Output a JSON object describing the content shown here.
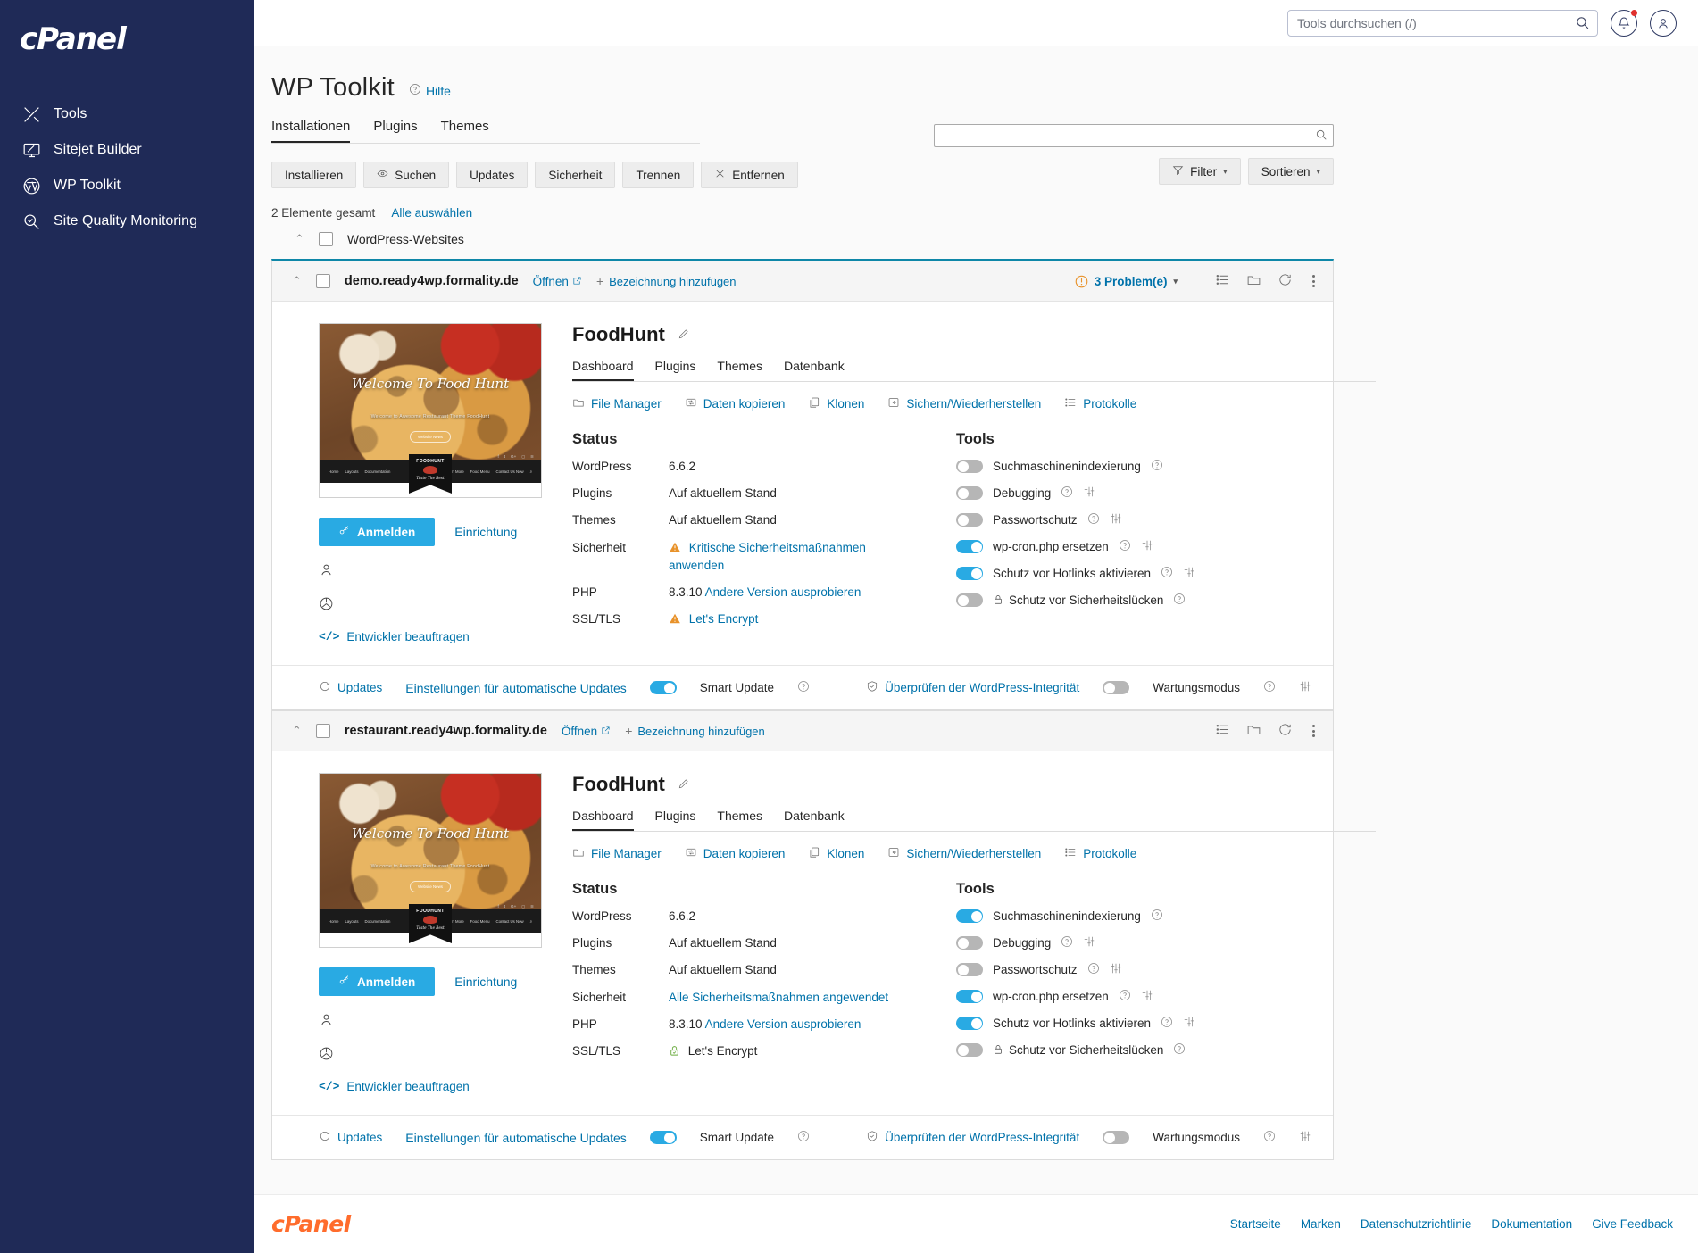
{
  "brand": {
    "logo_text": "cPanel",
    "footer_logo_text": "cPanel"
  },
  "sidebar": {
    "items": [
      {
        "label": "Tools",
        "icon": "tools-icon"
      },
      {
        "label": "Sitejet Builder",
        "icon": "monitor-icon"
      },
      {
        "label": "WP Toolkit",
        "icon": "wordpress-icon"
      },
      {
        "label": "Site Quality Monitoring",
        "icon": "magnifier-check-icon"
      }
    ]
  },
  "topbar": {
    "search_placeholder": "Tools durchsuchen (/)",
    "search_value": "",
    "notifications_icon": "bell-icon",
    "account_icon": "user-icon"
  },
  "page": {
    "title": "WP Toolkit",
    "help_label": "Hilfe",
    "tabs": [
      {
        "label": "Installationen",
        "active": true
      },
      {
        "label": "Plugins",
        "active": false
      },
      {
        "label": "Themes",
        "active": false
      }
    ],
    "buttons": [
      {
        "label": "Installieren",
        "icon": ""
      },
      {
        "label": "Suchen",
        "icon": "eye-icon"
      },
      {
        "label": "Updates",
        "icon": ""
      },
      {
        "label": "Sicherheit",
        "icon": ""
      },
      {
        "label": "Trennen",
        "icon": ""
      },
      {
        "label": "Entfernen",
        "icon": "close-icon"
      }
    ],
    "filter_search_value": "",
    "filter_label": "Filter",
    "sort_label": "Sortieren",
    "total_label": "2 Elemente gesamt",
    "select_all_label": "Alle auswählen",
    "group_label": "WordPress-Websites"
  },
  "installations": [
    {
      "domain": "demo.ready4wp.formality.de",
      "open_label": "Öffnen",
      "add_label_label": "Bezeichnung hinzufügen",
      "problems_label": "3 Problem(e)",
      "selected": true,
      "site_title": "FoodHunt",
      "inner_tabs": [
        {
          "label": "Dashboard",
          "active": true
        },
        {
          "label": "Plugins",
          "active": false
        },
        {
          "label": "Themes",
          "active": false
        },
        {
          "label": "Datenbank",
          "active": false
        }
      ],
      "action_links": [
        {
          "label": "File Manager",
          "icon": "folder-icon"
        },
        {
          "label": "Daten kopieren",
          "icon": "copy-data-icon"
        },
        {
          "label": "Klonen",
          "icon": "clone-icon"
        },
        {
          "label": "Sichern/Wiederherstellen",
          "icon": "restore-icon"
        },
        {
          "label": "Protokolle",
          "icon": "logs-icon"
        }
      ],
      "status_title": "Status",
      "status": [
        {
          "key": "WordPress",
          "value": "6.6.2",
          "link": "",
          "state": "plain"
        },
        {
          "key": "Plugins",
          "value": "Auf aktuellem Stand",
          "link": "",
          "state": "plain"
        },
        {
          "key": "Themes",
          "value": "Auf aktuellem Stand",
          "link": "",
          "state": "plain"
        },
        {
          "key": "Sicherheit",
          "value": "",
          "link": "Kritische Sicherheitsmaßnahmen anwenden",
          "state": "warning"
        },
        {
          "key": "PHP",
          "value": "8.3.10",
          "link": "Andere Version ausprobieren",
          "state": "plain"
        },
        {
          "key": "SSL/TLS",
          "value": "",
          "link": "Let's Encrypt",
          "state": "warning"
        }
      ],
      "tools_title": "Tools",
      "tools": [
        {
          "label": "Suchmaschinenindexierung",
          "on": false,
          "help": true,
          "settings": false,
          "lock": false
        },
        {
          "label": "Debugging",
          "on": false,
          "help": true,
          "settings": true,
          "lock": false
        },
        {
          "label": "Passwortschutz",
          "on": false,
          "help": true,
          "settings": true,
          "lock": false
        },
        {
          "label": "wp-cron.php ersetzen",
          "on": true,
          "help": true,
          "settings": true,
          "lock": false
        },
        {
          "label": "Schutz vor Hotlinks aktivieren",
          "on": true,
          "help": true,
          "settings": true,
          "lock": false
        },
        {
          "label": "Schutz vor Sicherheitslücken",
          "on": false,
          "help": true,
          "settings": false,
          "lock": true
        }
      ],
      "login_label": "Anmelden",
      "setup_label": "Einrichtung",
      "developer_label": "Entwickler beauftragen",
      "thumb": {
        "hero_title": "Welcome To Food Hunt",
        "hero_sub": "Welcome to Awesome Restaurant Theme FoodHunt",
        "hero_btn": "Website News",
        "nav_left": [
          "Home",
          "Layouts",
          "Documentation"
        ],
        "nav_right": [
          "Learn More",
          "Food Menu",
          "Contact Us Now"
        ],
        "logo_top": "FOODHUNT",
        "logo_bottom": "Taste The Best"
      },
      "footer": {
        "updates_label": "Updates",
        "auto_updates_label": "Einstellungen für automatische Updates",
        "smart_update_label": "Smart Update",
        "smart_update_on": true,
        "integrity_label": "Überprüfen der WordPress-Integrität",
        "maintenance_label": "Wartungsmodus",
        "maintenance_on": false
      }
    },
    {
      "domain": "restaurant.ready4wp.formality.de",
      "open_label": "Öffnen",
      "add_label_label": "Bezeichnung hinzufügen",
      "problems_label": "",
      "selected": false,
      "site_title": "FoodHunt",
      "inner_tabs": [
        {
          "label": "Dashboard",
          "active": true
        },
        {
          "label": "Plugins",
          "active": false
        },
        {
          "label": "Themes",
          "active": false
        },
        {
          "label": "Datenbank",
          "active": false
        }
      ],
      "action_links": [
        {
          "label": "File Manager",
          "icon": "folder-icon"
        },
        {
          "label": "Daten kopieren",
          "icon": "copy-data-icon"
        },
        {
          "label": "Klonen",
          "icon": "clone-icon"
        },
        {
          "label": "Sichern/Wiederherstellen",
          "icon": "restore-icon"
        },
        {
          "label": "Protokolle",
          "icon": "logs-icon"
        }
      ],
      "status_title": "Status",
      "status": [
        {
          "key": "WordPress",
          "value": "6.6.2",
          "link": "",
          "state": "plain"
        },
        {
          "key": "Plugins",
          "value": "Auf aktuellem Stand",
          "link": "",
          "state": "plain"
        },
        {
          "key": "Themes",
          "value": "Auf aktuellem Stand",
          "link": "",
          "state": "plain"
        },
        {
          "key": "Sicherheit",
          "value": "",
          "link": "Alle Sicherheitsmaßnahmen angewendet",
          "state": "plain"
        },
        {
          "key": "PHP",
          "value": "8.3.10",
          "link": "Andere Version ausprobieren",
          "state": "plain"
        },
        {
          "key": "SSL/TLS",
          "value": "Let's Encrypt",
          "link": "",
          "state": "secure"
        }
      ],
      "tools_title": "Tools",
      "tools": [
        {
          "label": "Suchmaschinenindexierung",
          "on": true,
          "help": true,
          "settings": false,
          "lock": false
        },
        {
          "label": "Debugging",
          "on": false,
          "help": true,
          "settings": true,
          "lock": false
        },
        {
          "label": "Passwortschutz",
          "on": false,
          "help": true,
          "settings": true,
          "lock": false
        },
        {
          "label": "wp-cron.php ersetzen",
          "on": true,
          "help": true,
          "settings": true,
          "lock": false
        },
        {
          "label": "Schutz vor Hotlinks aktivieren",
          "on": true,
          "help": true,
          "settings": true,
          "lock": false
        },
        {
          "label": "Schutz vor Sicherheitslücken",
          "on": false,
          "help": true,
          "settings": false,
          "lock": true
        }
      ],
      "login_label": "Anmelden",
      "setup_label": "Einrichtung",
      "developer_label": "Entwickler beauftragen",
      "thumb": {
        "hero_title": "Welcome To Food Hunt",
        "hero_sub": "Welcome to Awesome Restaurant Theme FoodHunt",
        "hero_btn": "Website News",
        "nav_left": [
          "Home",
          "Layouts",
          "Documentation"
        ],
        "nav_right": [
          "Learn More",
          "Food Menu",
          "Contact Us Now"
        ],
        "logo_top": "FOODHUNT",
        "logo_bottom": "Taste The Best"
      },
      "footer": {
        "updates_label": "Updates",
        "auto_updates_label": "Einstellungen für automatische Updates",
        "smart_update_label": "Smart Update",
        "smart_update_on": true,
        "integrity_label": "Überprüfen der WordPress-Integrität",
        "maintenance_label": "Wartungsmodus",
        "maintenance_on": false
      }
    }
  ],
  "site_footer": {
    "links": [
      "Startseite",
      "Marken",
      "Datenschutzrichtlinie",
      "Dokumentation",
      "Give Feedback"
    ]
  },
  "colors": {
    "sidebar_bg": "#1f2a57",
    "link": "#0072aa",
    "accent": "#29aae3",
    "warning": "#e8922a",
    "brand_orange": "#ff6c2c",
    "selected_border": "#0e87a8",
    "secure_green": "#6aab3e"
  }
}
